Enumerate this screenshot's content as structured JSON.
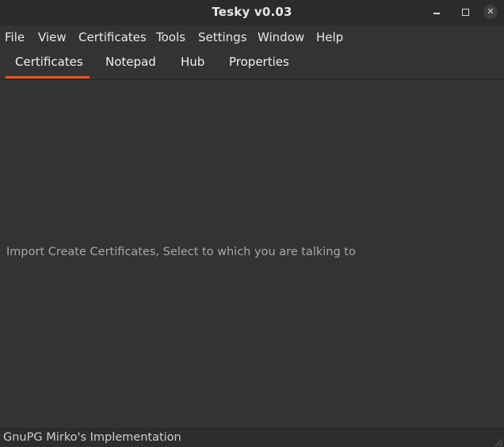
{
  "window": {
    "title": "Tesky v0.03"
  },
  "menubar": {
    "items": [
      {
        "label": "File"
      },
      {
        "label": "View"
      },
      {
        "label": "Certificates"
      },
      {
        "label": "Tools"
      },
      {
        "label": "Settings"
      },
      {
        "label": "Window"
      },
      {
        "label": "Help"
      }
    ]
  },
  "tabs": {
    "active": "Certificates",
    "items": [
      {
        "label": "Certificates"
      },
      {
        "label": "Notepad"
      },
      {
        "label": "Hub"
      },
      {
        "label": "Properties"
      }
    ]
  },
  "content": {
    "message": "Import Create Certificates, Select to which you are talking to"
  },
  "statusbar": {
    "text": "GnuPG Mirko's Implementation"
  },
  "colors": {
    "accent": "#e95420",
    "background": "#333333",
    "text": "#e8e8e8",
    "muted_text": "#a8a8a8"
  },
  "icons": {
    "minimize": "minimize-icon",
    "maximize": "maximize-icon",
    "close": "close-icon",
    "resize_grip": "resize-grip-icon"
  }
}
